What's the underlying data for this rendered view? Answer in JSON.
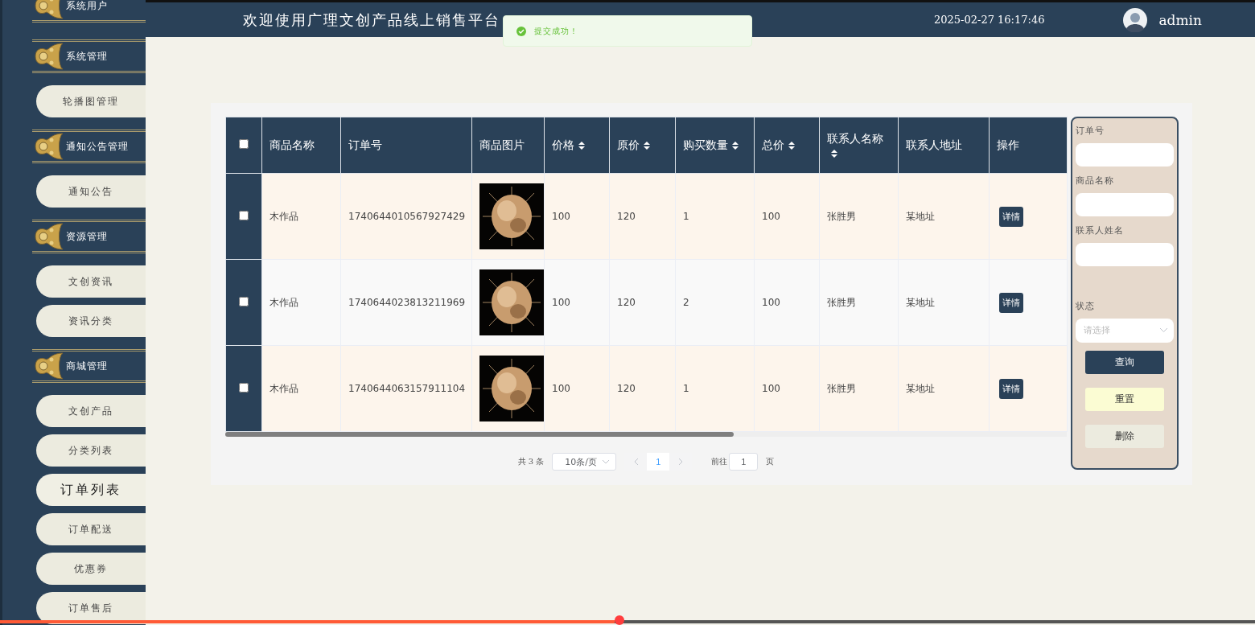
{
  "sidebar": {
    "items": [
      {
        "kind": "group",
        "label": "系统用户",
        "selected": false
      },
      {
        "kind": "group",
        "label": "系统管理",
        "selected": false
      },
      {
        "kind": "item",
        "label": "轮播图管理",
        "selected": false
      },
      {
        "kind": "group",
        "label": "通知公告管理",
        "selected": false
      },
      {
        "kind": "item",
        "label": "通知公告",
        "selected": false
      },
      {
        "kind": "group",
        "label": "资源管理",
        "selected": false
      },
      {
        "kind": "item",
        "label": "文创资讯",
        "selected": false
      },
      {
        "kind": "item",
        "label": "资讯分类",
        "selected": false
      },
      {
        "kind": "group",
        "label": "商城管理",
        "selected": false
      },
      {
        "kind": "item",
        "label": "文创产品",
        "selected": false
      },
      {
        "kind": "item",
        "label": "分类列表",
        "selected": false
      },
      {
        "kind": "item",
        "label": "订单列表",
        "selected": true
      },
      {
        "kind": "item",
        "label": "订单配送",
        "selected": false
      },
      {
        "kind": "item",
        "label": "优惠券",
        "selected": false
      },
      {
        "kind": "item",
        "label": "订单售后",
        "selected": false
      }
    ]
  },
  "header": {
    "title": "欢迎使用广理文创产品线上销售平台",
    "datetime": "2025-02-27 16:17:46",
    "user": "admin"
  },
  "toast": {
    "kind": "success",
    "message": "提交成功！"
  },
  "table": {
    "select_all_checked": false,
    "columns": [
      {
        "label": "商品名称",
        "sortable": false
      },
      {
        "label": "订单号",
        "sortable": false
      },
      {
        "label": "商品图片",
        "sortable": false
      },
      {
        "label": "价格",
        "sortable": true
      },
      {
        "label": "原价",
        "sortable": true
      },
      {
        "label": "购买数量",
        "sortable": true
      },
      {
        "label": "总价",
        "sortable": true
      },
      {
        "label": "联系人名称",
        "sortable": true
      },
      {
        "label": "联系人地址",
        "sortable": false
      },
      {
        "label": "操作",
        "sortable": false
      }
    ],
    "rows": [
      {
        "checked": false,
        "cells": [
          {
            "kind": "text",
            "text": "木作品"
          },
          {
            "kind": "text",
            "text": "1740644010567927429"
          },
          {
            "kind": "picture"
          },
          {
            "kind": "text",
            "text": "100"
          },
          {
            "kind": "text",
            "text": "120"
          },
          {
            "kind": "text",
            "text": "1"
          },
          {
            "kind": "text",
            "text": "100"
          },
          {
            "kind": "text",
            "text": "张胜男"
          },
          {
            "kind": "text",
            "text": "某地址"
          },
          {
            "kind": "button",
            "text": "详情"
          }
        ]
      },
      {
        "checked": false,
        "cells": [
          {
            "kind": "text",
            "text": "木作品"
          },
          {
            "kind": "text",
            "text": "1740644023813211969"
          },
          {
            "kind": "picture"
          },
          {
            "kind": "text",
            "text": "100"
          },
          {
            "kind": "text",
            "text": "120"
          },
          {
            "kind": "text",
            "text": "2"
          },
          {
            "kind": "text",
            "text": "100"
          },
          {
            "kind": "text",
            "text": "张胜男"
          },
          {
            "kind": "text",
            "text": "某地址"
          },
          {
            "kind": "button",
            "text": "详情"
          }
        ]
      },
      {
        "checked": false,
        "cells": [
          {
            "kind": "text",
            "text": "木作品"
          },
          {
            "kind": "text",
            "text": "1740644063157911104"
          },
          {
            "kind": "picture"
          },
          {
            "kind": "text",
            "text": "100"
          },
          {
            "kind": "text",
            "text": "120"
          },
          {
            "kind": "text",
            "text": "1"
          },
          {
            "kind": "text",
            "text": "100"
          },
          {
            "kind": "text",
            "text": "张胜男"
          },
          {
            "kind": "text",
            "text": "某地址"
          },
          {
            "kind": "button",
            "text": "详情"
          }
        ]
      }
    ]
  },
  "pagination": {
    "total": "共 3 条",
    "page_size": "10条/页",
    "pages": [
      {
        "label": "1",
        "selected": true
      }
    ],
    "goto_label": "前往",
    "goto_value": "1",
    "page_suffix": "页"
  },
  "search": {
    "fields": [
      {
        "kind": "text",
        "label": "订单号"
      },
      {
        "kind": "text",
        "label": "商品名称"
      },
      {
        "kind": "text",
        "label": "联系人姓名"
      },
      {
        "kind": "select",
        "label": "状态",
        "placeholder": "请选择"
      }
    ],
    "buttons": [
      {
        "kind": "primary",
        "label": "查询"
      },
      {
        "kind": "warning",
        "label": "重置"
      },
      {
        "kind": "default",
        "label": "删除"
      }
    ]
  },
  "video_progress": {
    "level": 0.49
  }
}
